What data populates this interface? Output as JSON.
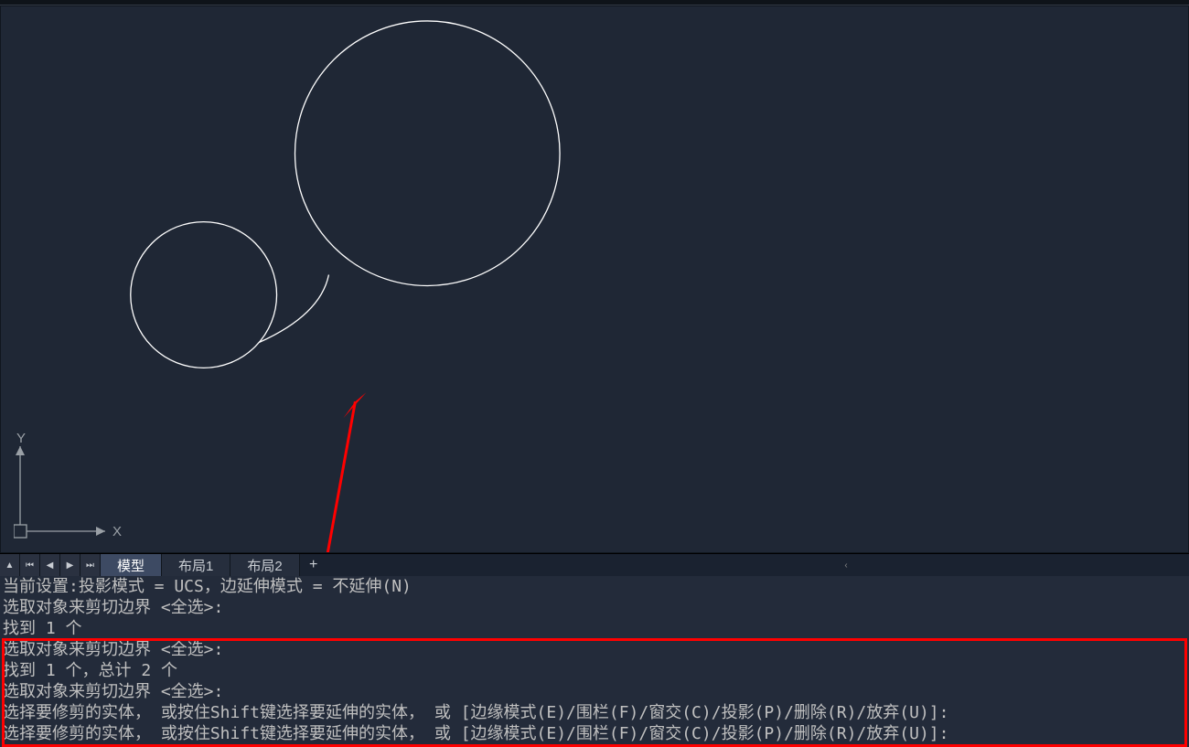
{
  "ucs": {
    "x_label": "X",
    "y_label": "Y"
  },
  "tabs": {
    "model": "模型",
    "layout1": "布局1",
    "layout2": "布局2",
    "add": "+"
  },
  "nav": {
    "collapse": "▲",
    "first": "⏮",
    "prev": "◀",
    "next": "▶",
    "last": "⏭",
    "scroll_left": "‹"
  },
  "command_lines": [
    "当前设置:投影模式 = UCS，边延伸模式 = 不延伸(N)",
    "选取对象来剪切边界 <全选>:",
    "找到 1 个",
    "选取对象来剪切边界 <全选>:",
    "找到 1 个，总计 2 个",
    "选取对象来剪切边界 <全选>:",
    "选择要修剪的实体， 或按住Shift键选择要延伸的实体， 或 [边缘模式(E)/围栏(F)/窗交(C)/投影(P)/删除(R)/放弃(U)]:",
    "选择要修剪的实体， 或按住Shift键选择要延伸的实体， 或 [边缘模式(E)/围栏(F)/窗交(C)/投影(P)/删除(R)/放弃(U)]:"
  ]
}
